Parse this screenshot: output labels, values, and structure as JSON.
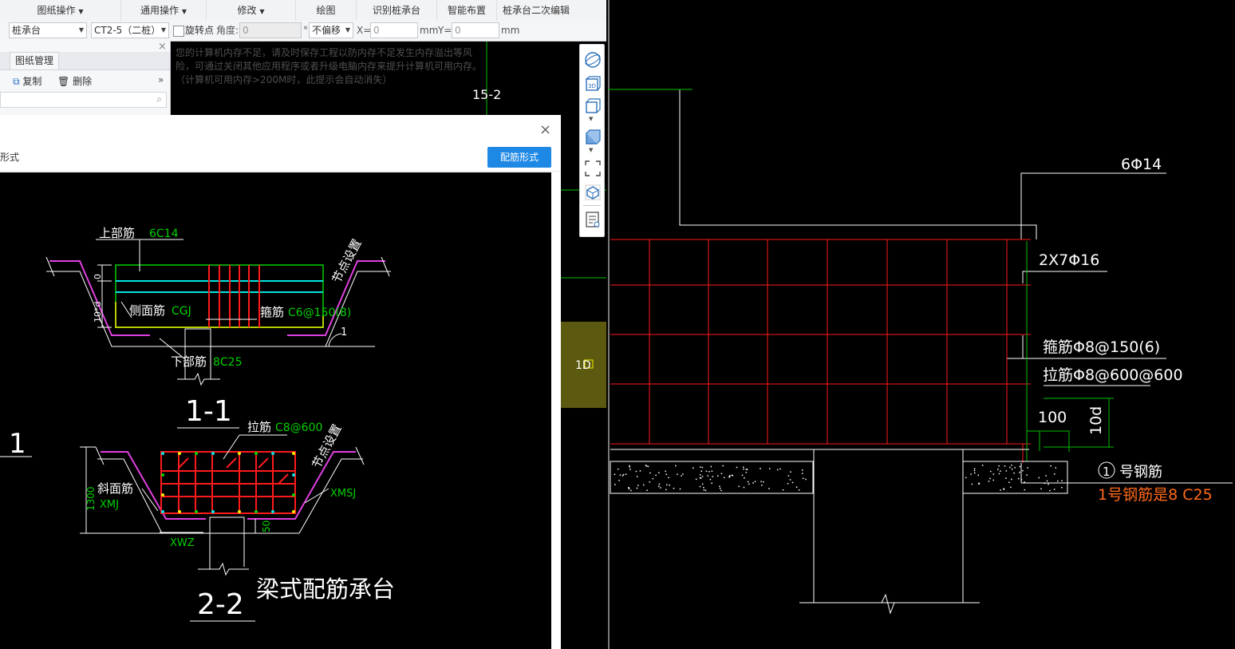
{
  "menubar": {
    "items": [
      "图纸操作",
      "通用操作",
      "修改",
      "绘图",
      "识别桩承台",
      "智能布置",
      "桩承台二次编辑"
    ]
  },
  "toolbar": {
    "component_type": "桩承台",
    "component_name": "CT2-5（二桩）",
    "rotate_label": "旋转点",
    "angle_label": "角度:",
    "angle_value": "0",
    "degree": "°",
    "offset_mode": "不偏移",
    "x_label": "X=",
    "x_value": "0",
    "mm1": "mm",
    "y_label": "Y=",
    "y_value": "0",
    "mm2": "mm"
  },
  "panel": {
    "tab": "图纸管理",
    "copy": "复制",
    "delete": "删除",
    "close": "×",
    "more": "»"
  },
  "notice": "您的计算机内存不足，请及时保存工程以防内存不足发生内存溢出等风险，可通过关闭其他应用程序或者升级电脑内存来提升计算机可用内存。（计算机可用内存>200M时，此提示会自动消失）",
  "axis_label": "15-2",
  "marker_label": "1D",
  "dialog": {
    "title_fragment": "形式",
    "button": "配筋形式",
    "close": "×",
    "fragment_1": "1",
    "section11": {
      "top_bar_label": "上部筋",
      "top_bar_value": "6C14",
      "side_bar_label": "侧面筋",
      "side_bar_value": "CGJ",
      "stirrup_label": "箍筋",
      "stirrup_value": "C6@150(8)",
      "bottom_bar_label": "下部筋",
      "bottom_bar_value": "8C25",
      "node_label": "节点设置",
      "dim_top": "0",
      "dim_side": "10*d",
      "slope": "1",
      "title": "1-1"
    },
    "section22": {
      "tie_label": "拉筋",
      "tie_value": "C8@600",
      "node_label": "节点设置",
      "slant_label": "斜面筋",
      "slant_value": "XMJ",
      "dim_height": "1300",
      "xmsj": "XMSJ",
      "xwz": "XWZ",
      "dim_50": "50",
      "title": "2-2",
      "caption": "梁式配筋承台"
    }
  },
  "cad_right": {
    "top_label": "6Φ14",
    "side_label": "2X7Φ16",
    "stirrup_label": "箍筋Φ8@150(6)",
    "tie_label": "拉筋Φ8@600@600",
    "dim_100": "100",
    "dim_10d": "10d",
    "bar_no": "1",
    "bar_label": "号钢筋",
    "bar_spec": "1号钢筋是8 C25"
  },
  "colors": {
    "cad_bg": "#000000",
    "red": "#ff1a1a",
    "green": "#00d000",
    "white": "#ffffff",
    "orange": "#ff6a1a",
    "magenta": "#e040e0",
    "cyan": "#00e5e5",
    "yellow": "#f0f000",
    "accent_blue": "#1e88e5"
  }
}
